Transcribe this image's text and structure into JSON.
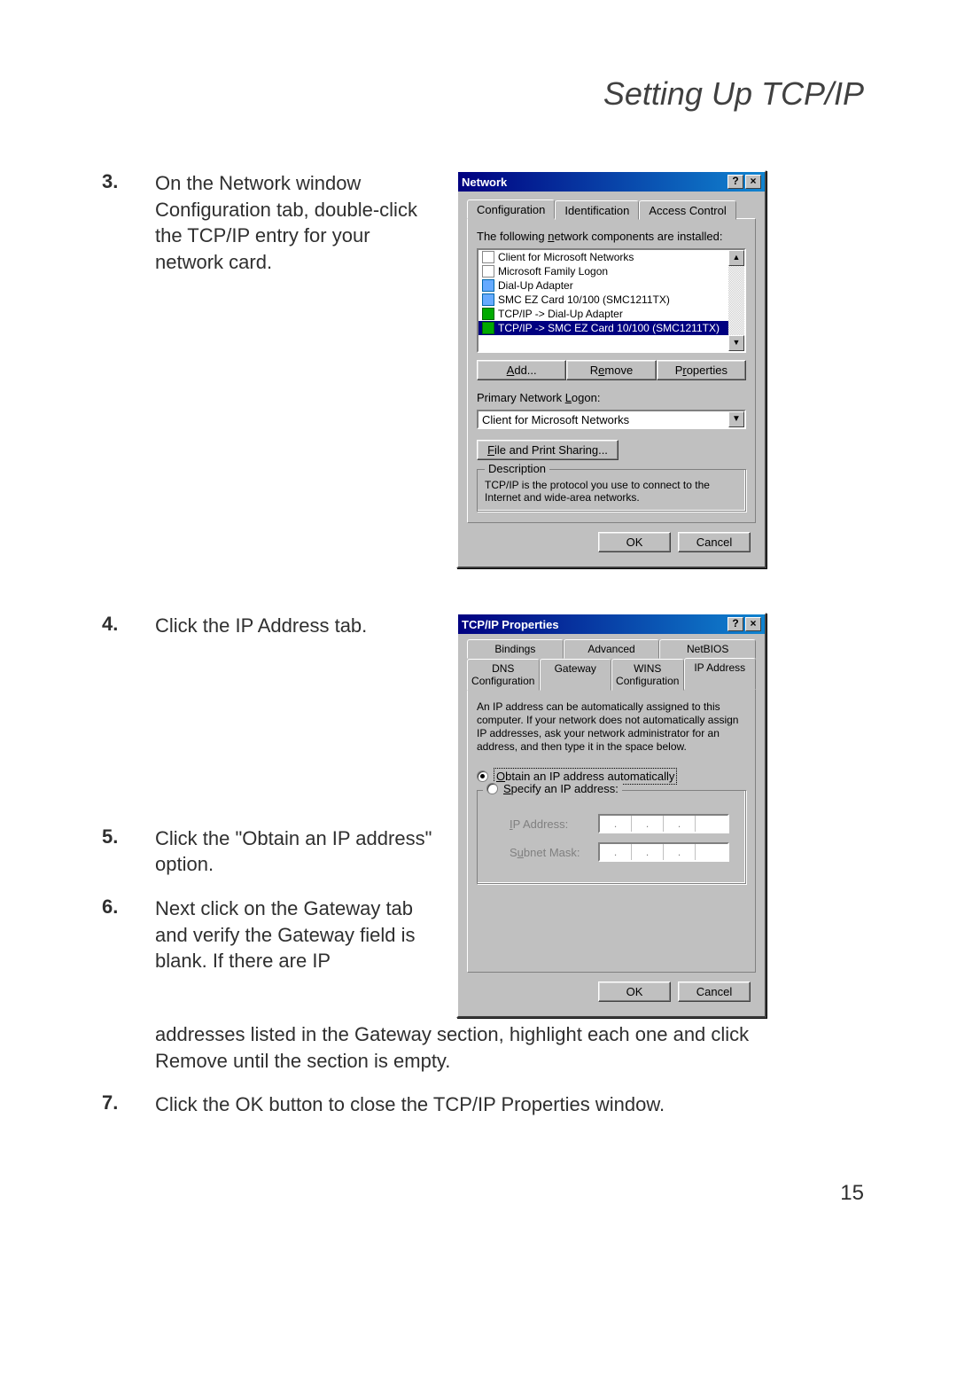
{
  "page": {
    "title": "Setting Up TCP/IP",
    "number": "15"
  },
  "steps": {
    "s3_num": "3.",
    "s3_text": "On the Network window Configuration tab, double-click the TCP/IP entry for your network card.",
    "s4_num": "4.",
    "s4_text": "Click the IP Address tab.",
    "s5_num": "5.",
    "s5_text": "Click the \"Obtain an IP address\" option.",
    "s6_num": "6.",
    "s6_text": "Next click on the Gateway tab and verify the Gateway field is blank. If there are IP addresses listed in the Gateway section, highlight each one and click Remove until the section is empty.",
    "s7_num": "7.",
    "s7_text": "Click the OK button to close the TCP/IP Properties window."
  },
  "win1": {
    "title": "Network",
    "tabs": {
      "config": "Configuration",
      "ident": "Identification",
      "access": "Access Control"
    },
    "label_components": "The following network components are installed:",
    "list": {
      "i0": "Client for Microsoft Networks",
      "i1": "Microsoft Family Logon",
      "i2": "Dial-Up Adapter",
      "i3": "SMC EZ Card 10/100 (SMC1211TX)",
      "i4": "TCP/IP -> Dial-Up Adapter",
      "i5": "TCP/IP -> SMC EZ Card 10/100 (SMC1211TX)"
    },
    "btn_add": "Add...",
    "btn_remove": "Remove",
    "btn_props": "Properties",
    "label_primary": "Primary Network Logon:",
    "primary_value": "Client for Microsoft Networks",
    "btn_fps": "File and Print Sharing...",
    "group_desc_title": "Description",
    "group_desc_text": "TCP/IP is the protocol you use to connect to the Internet and wide-area networks.",
    "ok": "OK",
    "cancel": "Cancel"
  },
  "win2": {
    "title": "TCP/IP Properties",
    "tabs_top": {
      "bind": "Bindings",
      "adv": "Advanced",
      "netbios": "NetBIOS"
    },
    "tabs_bot": {
      "dns": "DNS Configuration",
      "gw": "Gateway",
      "wins": "WINS Configuration",
      "ip": "IP Address"
    },
    "body_text": "An IP address can be automatically assigned to this computer. If your network does not automatically assign IP addresses, ask your network administrator for an address, and then type it in the space below.",
    "radio_auto": "Obtain an IP address automatically",
    "radio_spec": "Specify an IP address:",
    "lbl_ip": "IP Address:",
    "lbl_mask": "Subnet Mask:",
    "ok": "OK",
    "cancel": "Cancel"
  }
}
